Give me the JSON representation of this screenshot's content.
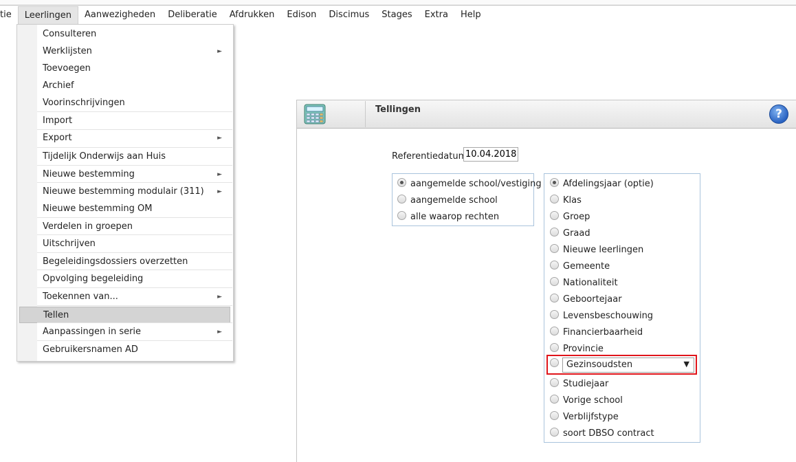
{
  "menubar": {
    "items": [
      "tie",
      "Leerlingen",
      "Aanwezigheden",
      "Deliberatie",
      "Afdrukken",
      "Edison",
      "Discimus",
      "Stages",
      "Extra",
      "Help"
    ]
  },
  "dropdown": {
    "items": [
      {
        "label": "Consulteren",
        "submenu": false
      },
      {
        "label": "Werklijsten",
        "submenu": true
      },
      {
        "label": "Toevoegen",
        "submenu": false
      },
      {
        "label": "Archief",
        "submenu": false
      },
      {
        "label": "Voorinschrijvingen",
        "submenu": false
      },
      {
        "label": "Import",
        "submenu": false
      },
      {
        "label": "Export",
        "submenu": true
      },
      {
        "label": "Tijdelijk Onderwijs aan Huis",
        "submenu": false
      },
      {
        "label": "Nieuwe bestemming",
        "submenu": true
      },
      {
        "label": "Nieuwe bestemming modulair (311)",
        "submenu": true
      },
      {
        "label": "Nieuwe bestemming OM",
        "submenu": false
      },
      {
        "label": "Verdelen in groepen",
        "submenu": false
      },
      {
        "label": "Uitschrijven",
        "submenu": false
      },
      {
        "label": "Begeleidingsdossiers overzetten",
        "submenu": false
      },
      {
        "label": "Opvolging begeleiding",
        "submenu": false
      },
      {
        "label": "Toekennen van...",
        "submenu": true
      },
      {
        "label": "Tellen",
        "submenu": false,
        "active": true
      },
      {
        "label": "Aanpassingen in serie",
        "submenu": true
      },
      {
        "label": "Gebruikersnamen AD",
        "submenu": false
      }
    ],
    "submenu_arrow": "►"
  },
  "panel": {
    "title": "Tellingen",
    "help_symbol": "?",
    "icon": "calculator-icon"
  },
  "form": {
    "ref_label": "Referentiedatum:",
    "ref_value": "10.04.2018",
    "scope_options": [
      {
        "label": "aangemelde school/vestiging",
        "checked": true
      },
      {
        "label": "aangemelde school",
        "checked": false
      },
      {
        "label": "alle waarop rechten",
        "checked": false
      }
    ],
    "group_options": [
      {
        "label": "Afdelingsjaar (optie)",
        "checked": true
      },
      {
        "label": "Klas",
        "checked": false
      },
      {
        "label": "Groep",
        "checked": false
      },
      {
        "label": "Graad",
        "checked": false
      },
      {
        "label": "Nieuwe leerlingen",
        "checked": false
      },
      {
        "label": "Gemeente",
        "checked": false
      },
      {
        "label": "Nationaliteit",
        "checked": false
      },
      {
        "label": "Geboortejaar",
        "checked": false
      },
      {
        "label": "Levensbeschouwing",
        "checked": false
      },
      {
        "label": "Financierbaarheid",
        "checked": false
      },
      {
        "label": "Provincie",
        "checked": false
      },
      {
        "label": "Studiejaar",
        "checked": false
      },
      {
        "label": "Vorige school",
        "checked": false
      },
      {
        "label": "Verblijfstype",
        "checked": false
      },
      {
        "label": "soort DBSO contract",
        "checked": false
      }
    ],
    "select_value": "Gezinsoudsten",
    "select_arrow": "▼"
  },
  "colors": {
    "highlight": "#e0141a",
    "box_border": "#a9c3dc"
  }
}
